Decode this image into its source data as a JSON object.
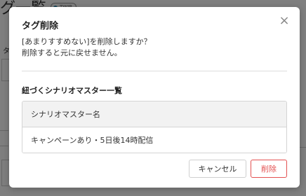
{
  "background": {
    "page_title": "グ一覧",
    "badge": "TWIP",
    "label": "タ"
  },
  "dialog": {
    "title": "タグ削除",
    "close_icon": "×",
    "message_line1": "[あまりすすめない]を削除しますか？",
    "message_line2": "削除すると元に戻せません。",
    "section_title": "紐づくシナリオマスター一覧",
    "table": {
      "header": "シナリオマスター名",
      "rows": [
        "キャンペーンあり・5日後14時配信"
      ]
    },
    "cancel_label": "キャンセル",
    "delete_label": "削除"
  },
  "colors": {
    "overlay": "rgba(0,0,0,0.5)",
    "danger": "#e35050",
    "table_header_bg": "#f2f2f2"
  }
}
